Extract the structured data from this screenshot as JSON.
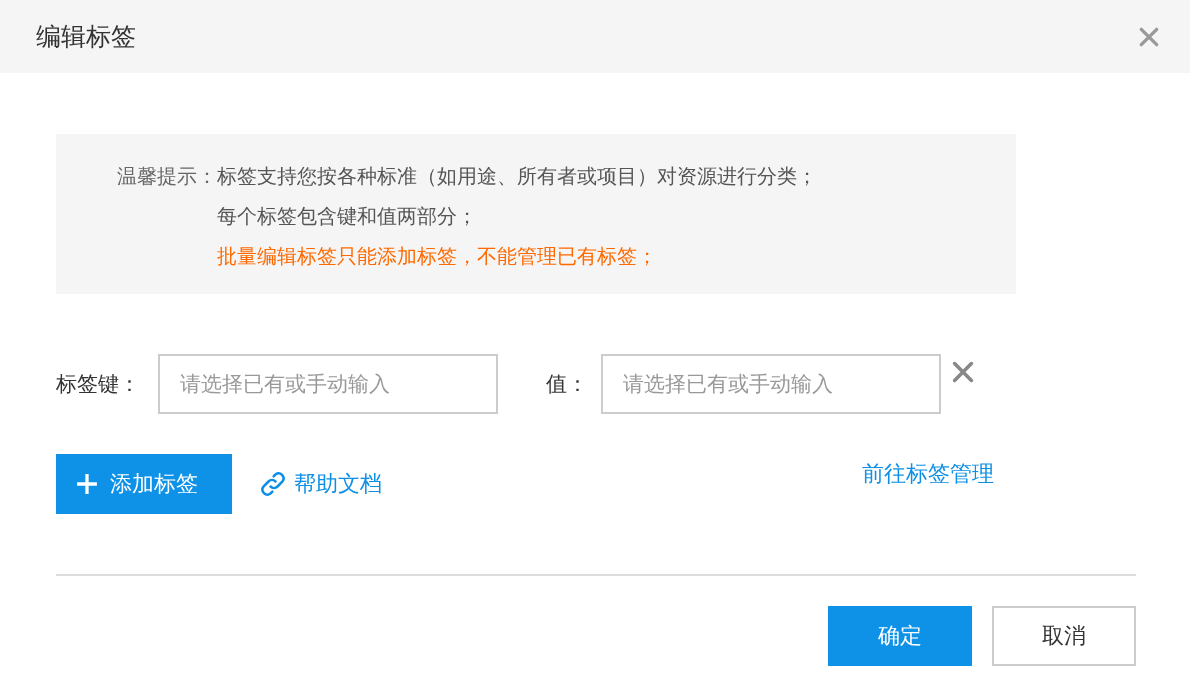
{
  "dialog": {
    "title": "编辑标签"
  },
  "notice": {
    "label": "温馨提示：",
    "lines": [
      {
        "text": "标签支持您按各种标准（如用途、所有者或项目）对资源进行分类；",
        "kind": "normal"
      },
      {
        "text": "每个标签包含键和值两部分；",
        "kind": "normal"
      },
      {
        "text": "批量编辑标签只能添加标签，不能管理已有标签；",
        "kind": "warning"
      }
    ]
  },
  "tag_rows": [
    {
      "key_label": "标签键：",
      "key_placeholder": "请选择已有或手动输入",
      "value_label": "值：",
      "value_placeholder": "请选择已有或手动输入"
    }
  ],
  "actions": {
    "add_button": "添加标签",
    "help_link": "帮助文档",
    "manage_link": "前往标签管理"
  },
  "footer": {
    "buttons": [
      {
        "label": "确定",
        "kind": "primary"
      },
      {
        "label": "取消",
        "kind": "default"
      }
    ]
  }
}
